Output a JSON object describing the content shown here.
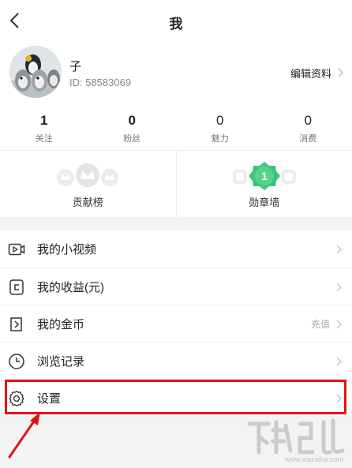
{
  "header": {
    "title": "我"
  },
  "profile": {
    "nickname": "子",
    "id_text": "ID: 58583069",
    "edit_label": "编辑资料"
  },
  "stats": [
    {
      "value": "1",
      "label": "关注"
    },
    {
      "value": "0",
      "label": "粉丝"
    },
    {
      "value": "0",
      "label": "魅力"
    },
    {
      "value": "0",
      "label": "消费"
    }
  ],
  "honors": [
    {
      "label": "贡献榜",
      "icon": "crown-icon"
    },
    {
      "label": "勋章墙",
      "icon": "medal-icon",
      "badge_number": "1",
      "badge_color": "#3cc47c"
    }
  ],
  "menu": [
    {
      "label": "我的小视频",
      "icon": "video-icon"
    },
    {
      "label": "我的收益(元)",
      "icon": "wallet-icon"
    },
    {
      "label": "我的金币",
      "icon": "coin-icon",
      "extra": "充值"
    },
    {
      "label": "浏览记录",
      "icon": "clock-icon"
    },
    {
      "label": "设置",
      "icon": "gear-icon"
    }
  ],
  "watermark": {
    "url": "www.xiazaiba.com"
  },
  "colors": {
    "annotation": "#e01414",
    "badge": "#3cc47c",
    "page_bg": "#f3f3f3"
  }
}
